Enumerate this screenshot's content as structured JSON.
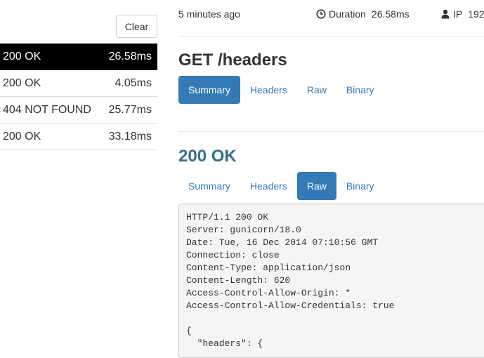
{
  "sidebar": {
    "clear_label": "Clear",
    "requests": [
      {
        "status": "200 OK",
        "time": "26.58ms"
      },
      {
        "status": "200 OK",
        "time": "4.05ms"
      },
      {
        "status": "404 NOT FOUND",
        "time": "25.77ms"
      },
      {
        "status": "200 OK",
        "time": "33.18ms"
      }
    ]
  },
  "meta": {
    "time_ago": "5 minutes ago",
    "duration_label": "Duration",
    "duration_value": "26.58ms",
    "ip_label": "IP",
    "ip_value": "192"
  },
  "request": {
    "title": "GET /headers",
    "tabs": [
      "Summary",
      "Headers",
      "Raw",
      "Binary"
    ]
  },
  "response": {
    "title": "200 OK",
    "tabs": [
      "Summary",
      "Headers",
      "Raw",
      "Binary"
    ],
    "raw": "HTTP/1.1 200 OK\nServer: gunicorn/18.0\nDate: Tue, 16 Dec 2014 07:10:56 GMT\nConnection: close\nContent-Type: application/json\nContent-Length: 620\nAccess-Control-Allow-Origin: *\nAccess-Control-Allow-Credentials: true\n\n{\n  \"headers\": {"
  },
  "colors": {
    "accent": "#337ab7",
    "response_title": "#31708f",
    "active_row": "#000000"
  }
}
